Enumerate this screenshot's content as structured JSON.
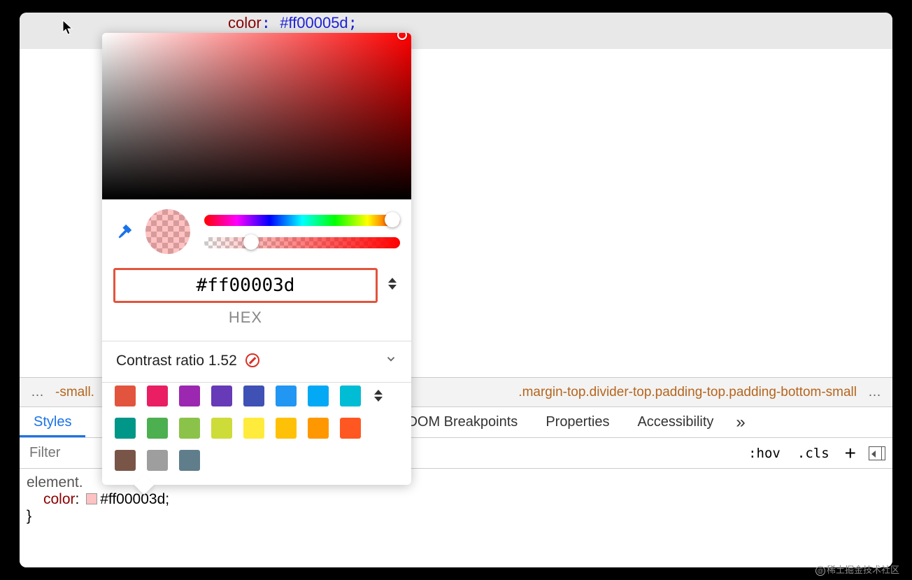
{
  "css_hint": {
    "property": "color",
    "value": "#ff00005d"
  },
  "picker": {
    "hex_value": "#ff00003d",
    "hex_label": "HEX",
    "contrast_label_prefix": "Contrast ratio",
    "contrast_value": "1.52",
    "hue_handle_pct": 96,
    "alpha_handle_pct": 24,
    "palette": {
      "row1": [
        "#e2543d",
        "#e91e63",
        "#9c27b0",
        "#673ab7",
        "#3f51b5",
        "#2196f3",
        "#03a9f4",
        "#00bcd4"
      ],
      "row2": [
        "#009688",
        "#4caf50",
        "#8bc34a",
        "#cddc39",
        "#ffeb3b",
        "#ffc107",
        "#ff9800",
        "#ff5722"
      ],
      "row3": [
        "#795548",
        "#9e9e9e",
        "#607d8b"
      ]
    }
  },
  "breadcrumb": {
    "left": "-small.",
    "classes": ".margin-top.divider-top.padding-top.padding-bottom-small"
  },
  "tabs": {
    "styles": "Styles",
    "dom_breakpoints": "DOM Breakpoints",
    "properties": "Properties",
    "accessibility": "Accessibility"
  },
  "toolbar": {
    "filter_placeholder": "Filter",
    "hov": ":hov",
    "cls": ".cls"
  },
  "rules": {
    "selector": "element.",
    "open_brace_vis": "{",
    "prop": "color",
    "value_text": "#ff00003d",
    "close_brace": "}"
  },
  "watermark": "稀土掘金技术社区"
}
